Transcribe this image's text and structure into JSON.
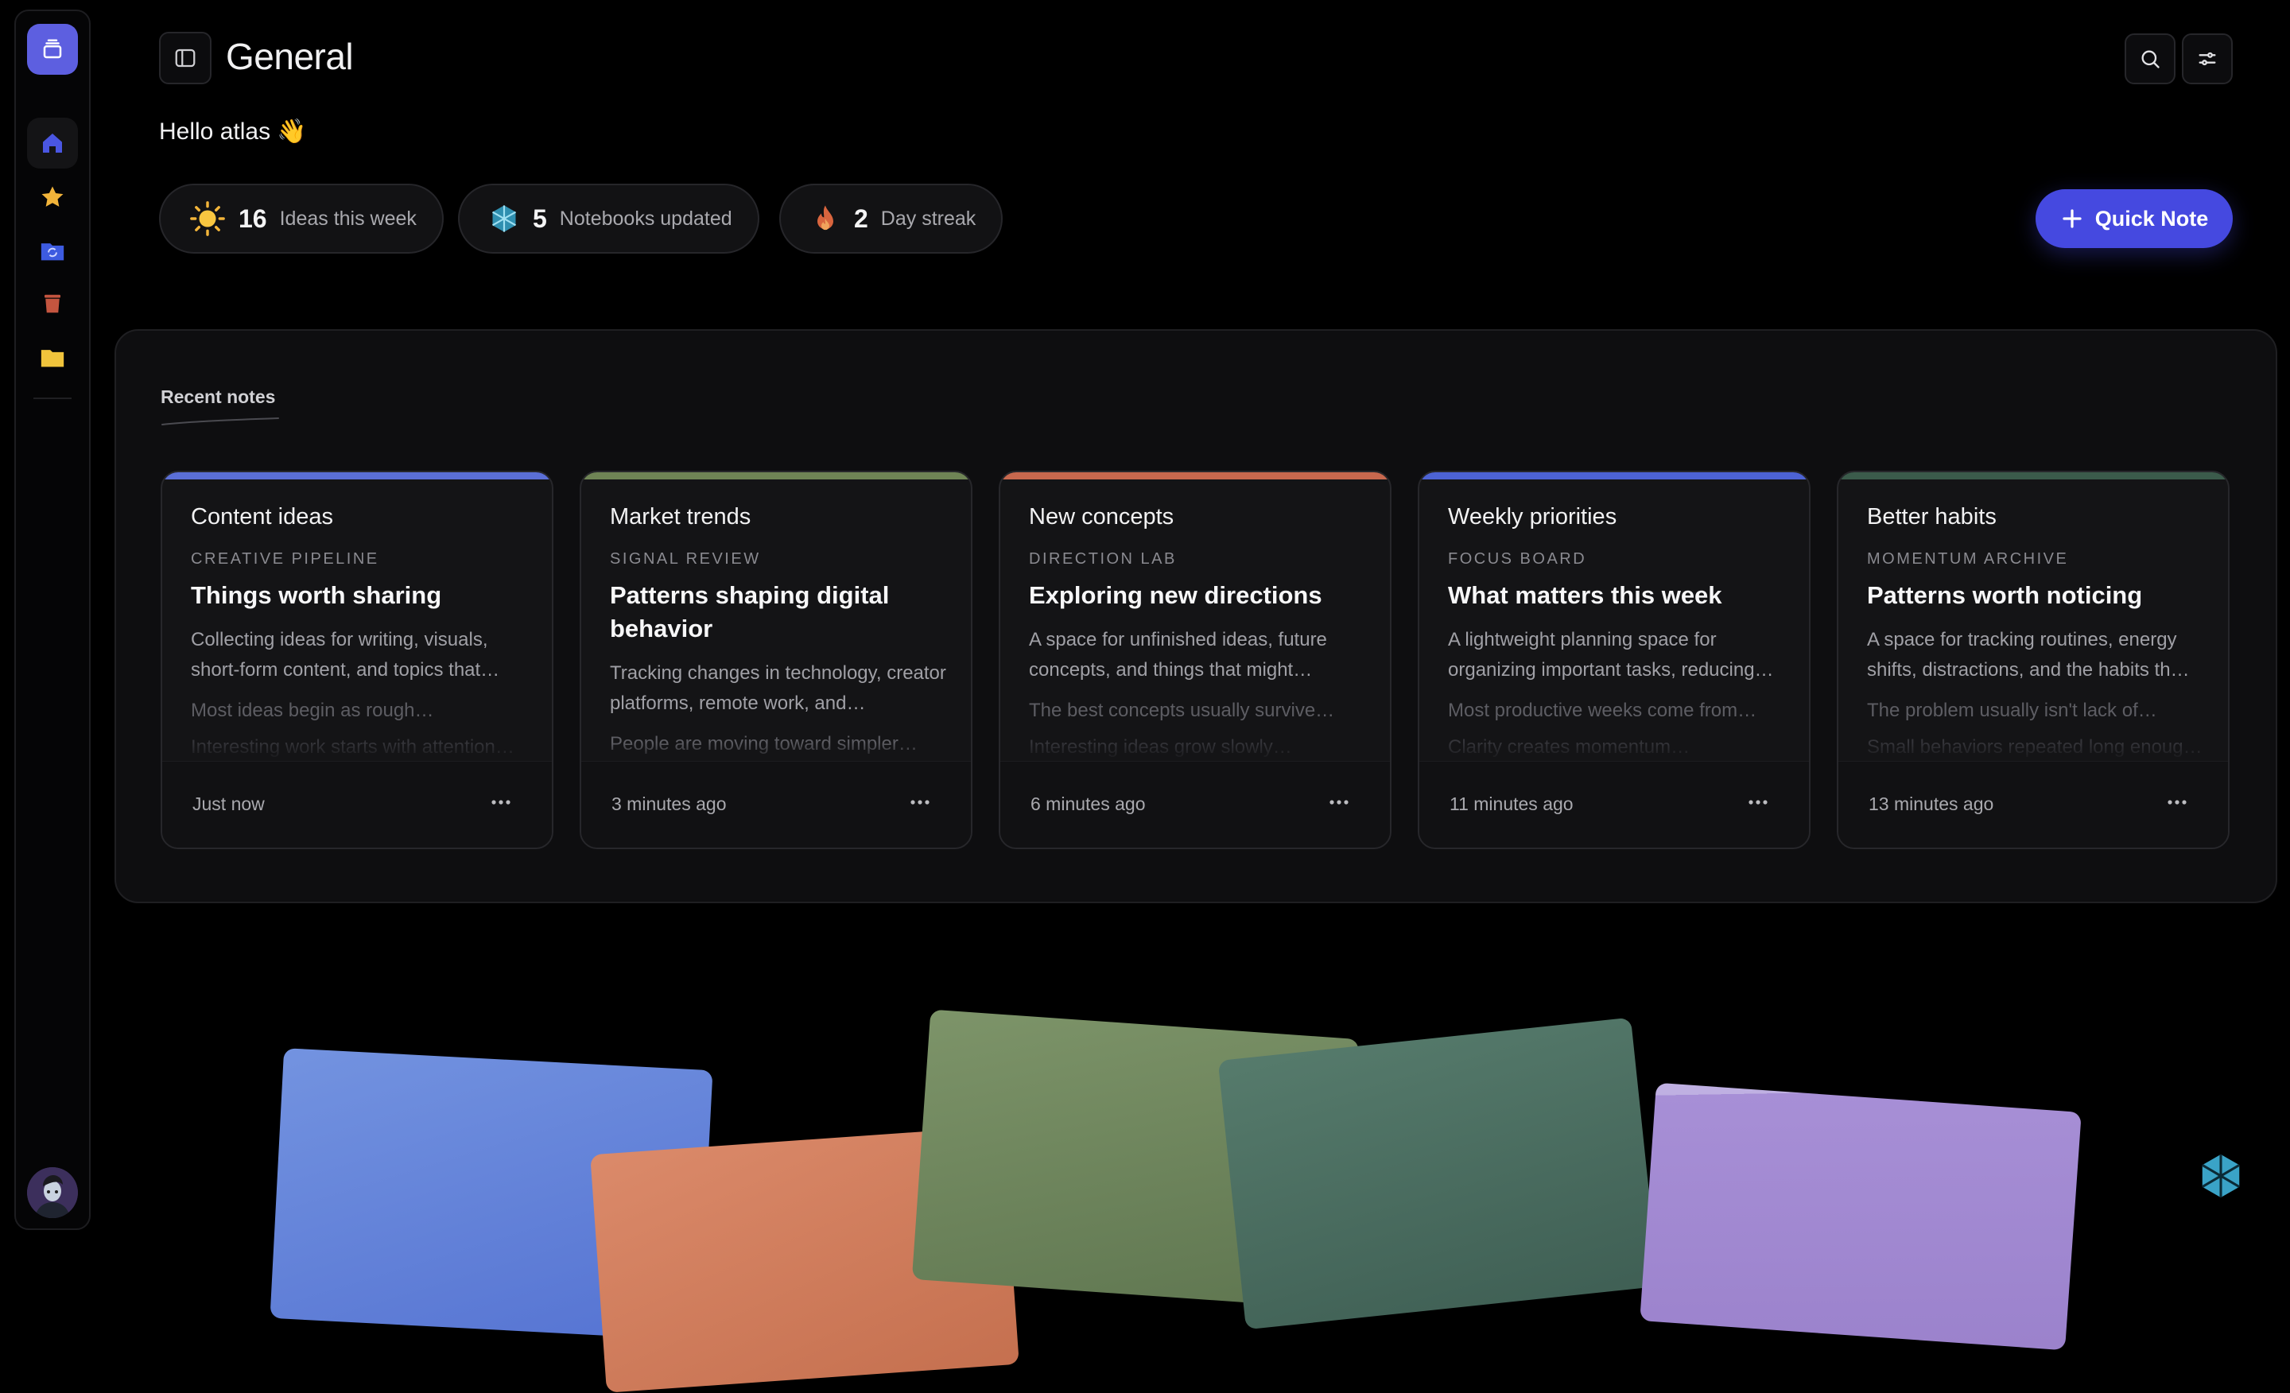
{
  "header": {
    "title": "General",
    "greeting": "Hello atlas 👋"
  },
  "sidebar": {
    "logo_icon": "stack-icon",
    "items": [
      {
        "icon": "home-icon",
        "active": true
      },
      {
        "icon": "star-icon",
        "active": false
      },
      {
        "icon": "sync-folder-icon",
        "active": false
      },
      {
        "icon": "trash-icon",
        "active": false
      },
      {
        "icon": "folder-icon",
        "active": false
      }
    ],
    "avatar": "user-avatar"
  },
  "stats": [
    {
      "icon": "sun-icon",
      "value": "16",
      "label": "Ideas this week"
    },
    {
      "icon": "hexagon-logo-icon",
      "value": "5",
      "label": "Notebooks updated"
    },
    {
      "icon": "flame-icon",
      "value": "2",
      "label": "Day streak"
    }
  ],
  "quick_note": {
    "label": "Quick Note"
  },
  "recent": {
    "title": "Recent notes",
    "cards": [
      {
        "notebook": "Content ideas",
        "category": "CREATIVE PIPELINE",
        "title": "Things worth sharing",
        "description": "Collecting ideas for writing, visuals, short-form content, and topics that…",
        "line1": "Most ideas begin as rough…",
        "line2": "Interesting work starts with attention…",
        "time": "Just now",
        "color": "#5b6fd6"
      },
      {
        "notebook": "Market trends",
        "category": "SIGNAL REVIEW",
        "title": "Patterns shaping digital behavior",
        "description": "Tracking changes in technology, creator platforms, remote work, and…",
        "line1": "People are moving toward simpler…",
        "line2": "",
        "time": "3 minutes ago",
        "color": "#6f8455"
      },
      {
        "notebook": "New concepts",
        "category": "DIRECTION LAB",
        "title": "Exploring new directions",
        "description": "A space for unfinished ideas, future concepts, and things that might…",
        "line1": "The best concepts usually survive…",
        "line2": "Interesting ideas grow slowly…",
        "time": "6 minutes ago",
        "color": "#c7684e"
      },
      {
        "notebook": "Weekly priorities",
        "category": "FOCUS BOARD",
        "title": "What matters this week",
        "description": "A lightweight planning space for organizing important tasks, reducing…",
        "line1": "Most productive weeks come from…",
        "line2": "Clarity creates momentum…",
        "time": "11 minutes ago",
        "color": "#4d63d4"
      },
      {
        "notebook": "Better habits",
        "category": "MOMENTUM ARCHIVE",
        "title": "Patterns worth noticing",
        "description": "A space for tracking routines, energy shifts, distractions, and the habits th…",
        "line1": "The problem usually isn't lack of…",
        "line2": "Small behaviors repeated long enoug…",
        "time": "13 minutes ago",
        "color": "#3b5b4b"
      }
    ]
  },
  "colors": {
    "accent": "#4549e0",
    "background": "#000000",
    "panel": "#0e0e10"
  }
}
